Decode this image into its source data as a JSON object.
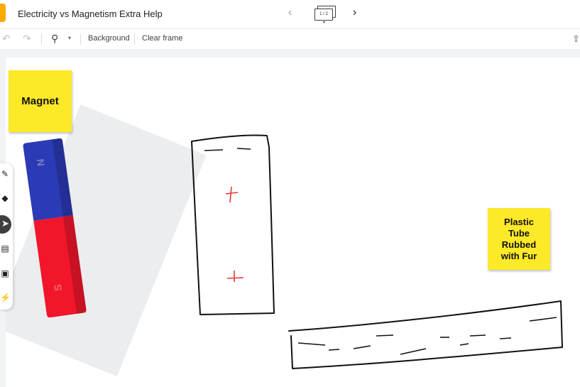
{
  "header": {
    "title": "Electricity vs Magnetism Extra Help",
    "frame_indicator": "1 / 2",
    "prev_icon": "chevron-left-icon",
    "next_icon": "chevron-right-icon",
    "more_icon": "more-vert-icon"
  },
  "toolbar": {
    "undo_icon": "undo-icon",
    "redo_icon": "redo-icon",
    "zoom_icon": "zoom-icon",
    "background_label": "Background",
    "clear_frame_label": "Clear frame",
    "present_icon": "present-icon"
  },
  "canvas": {
    "sticky_magnet": "Magnet",
    "sticky_tube_lines": [
      "Plastic",
      "Tube",
      "Rubbed",
      "with Fur"
    ],
    "ink_color": "#111111",
    "plus_color": "#e53935",
    "sticky_color": "#fce927"
  },
  "sidebar": {
    "tools": [
      "pen-icon",
      "eraser-icon",
      "select-icon",
      "sticky-note-icon",
      "image-icon",
      "laser-icon"
    ],
    "active_tool": "select-icon"
  }
}
